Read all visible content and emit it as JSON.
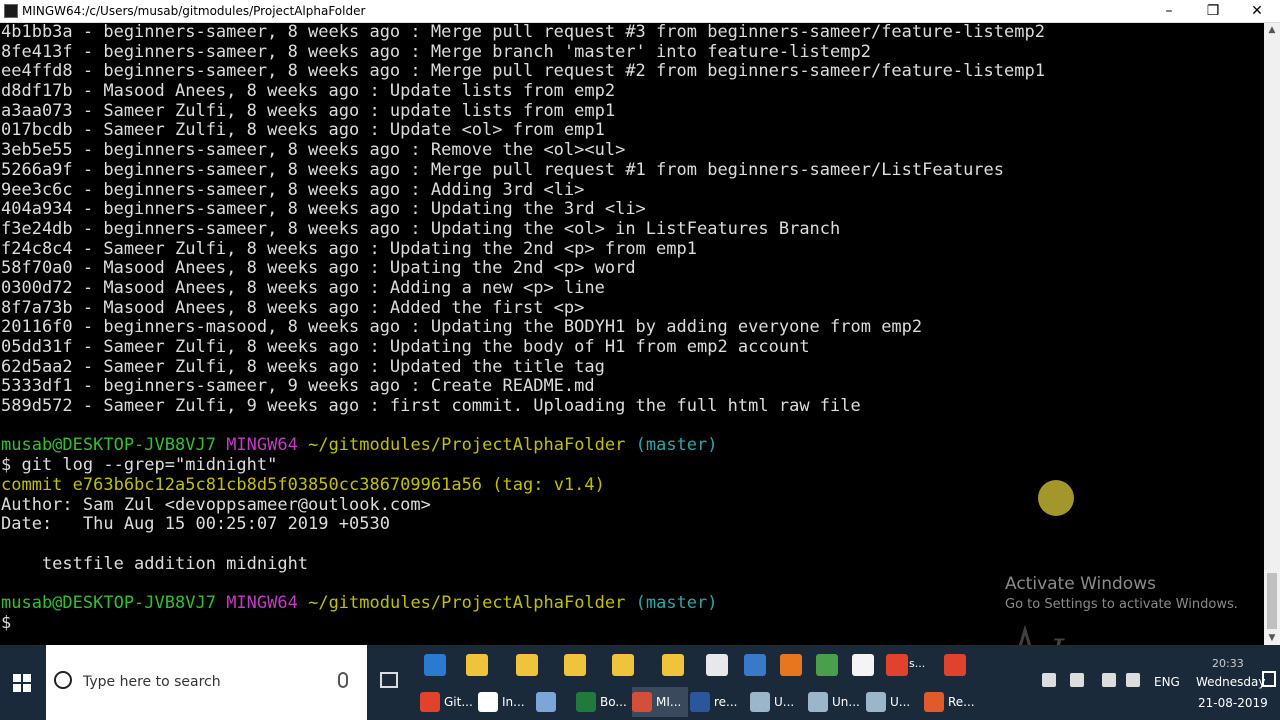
{
  "window": {
    "title": "MINGW64:/c/Users/musab/gitmodules/ProjectAlphaFolder",
    "minimize_icon": "minimize-icon",
    "maximize_icon": "maximize-icon",
    "close_icon": "close-icon"
  },
  "terminal": {
    "log_lines": [
      "4b1bb3a - beginners-sameer, 8 weeks ago : Merge pull request #3 from beginners-sameer/feature-listemp2",
      "8fe413f - beginners-sameer, 8 weeks ago : Merge branch 'master' into feature-listemp2",
      "ee4ffd8 - beginners-sameer, 8 weeks ago : Merge pull request #2 from beginners-sameer/feature-listemp1",
      "d8df17b - Masood Anees, 8 weeks ago : Update lists from emp2",
      "a3aa073 - Sameer Zulfi, 8 weeks ago : update lists from emp1",
      "017bcdb - Sameer Zulfi, 8 weeks ago : Update <ol> from emp1",
      "3eb5e55 - beginners-sameer, 8 weeks ago : Remove the <ol><ul>",
      "5266a9f - beginners-sameer, 8 weeks ago : Merge pull request #1 from beginners-sameer/ListFeatures",
      "9ee3c6c - beginners-sameer, 8 weeks ago : Adding 3rd <li>",
      "404a934 - beginners-sameer, 8 weeks ago : Updating the 3rd <li>",
      "f3e24db - beginners-sameer, 8 weeks ago : Updating the <ol> in ListFeatures Branch",
      "f24c8c4 - Sameer Zulfi, 8 weeks ago : Updating the 2nd <p> from emp1",
      "58f70a0 - Masood Anees, 8 weeks ago : Upating the 2nd <p> word",
      "0300d72 - Masood Anees, 8 weeks ago : Adding a new <p> line",
      "8f7a73b - Masood Anees, 8 weeks ago : Added the first <p>",
      "20116f0 - beginners-masood, 8 weeks ago : Updating the BODYH1 by adding everyone from emp2",
      "05dd31f - Sameer Zulfi, 8 weeks ago : Updating the body of H1 from emp2 account",
      "62d5aa2 - Sameer Zulfi, 8 weeks ago : Updated the title tag",
      "5333df1 - beginners-sameer, 9 weeks ago : Create README.md",
      "589d572 - Sameer Zulfi, 9 weeks ago : first commit. Uploading the full html raw file"
    ],
    "prompt": {
      "user_host": "musab@DESKTOP-JVB8VJ7",
      "env": "MINGW64",
      "path": "~/gitmodules/ProjectAlphaFolder",
      "branch": "(master)",
      "symbol": "$"
    },
    "command": "$ git log --grep=\"midnight\"",
    "commit_line": "commit e763b6bc12a5c81cb8d5f03850cc386709961a56",
    "tag": "(tag: v1.4)",
    "author_line": "Author: Sam Zul <devoppsameer@outlook.com>",
    "date_line": "Date:   Thu Aug 15 00:25:07 2019 +0530",
    "message_line": "    testfile addition midnight"
  },
  "overlay": {
    "activate_title": "Activate Windows",
    "activate_sub": "Go to Settings to activate Windows."
  },
  "taskbar": {
    "start_icon": "windows-start-icon",
    "search_placeholder": "Type here to search",
    "tasks": [
      {
        "label": "Git...",
        "icon": "chrome-icon",
        "color": "#e0422c"
      },
      {
        "label": "In...",
        "icon": "mail-icon",
        "color": "#ffffff"
      },
      {
        "label": "",
        "icon": "paint-icon",
        "color": "#7aa7d8"
      },
      {
        "label": "Bo...",
        "icon": "excel-icon",
        "color": "#1f7a3c"
      },
      {
        "label": "MI...",
        "icon": "git-bash-icon",
        "color": "#d44e3a"
      },
      {
        "label": "re...",
        "icon": "word-icon",
        "color": "#2b579a"
      },
      {
        "label": "U...",
        "icon": "app-icon",
        "color": "#9ab6c8"
      },
      {
        "label": "Un...",
        "icon": "app-icon",
        "color": "#9ab6c8"
      },
      {
        "label": "U...",
        "icon": "app-icon",
        "color": "#9ab6c8"
      },
      {
        "label": "Re...",
        "icon": "recorder-icon",
        "color": "#e05a2a"
      }
    ],
    "pinned_top": [
      {
        "icon": "edge-icon",
        "color": "#2a7ad0"
      },
      {
        "icon": "explorer-icon",
        "color": "#f0c43a"
      },
      {
        "icon": "explorer-icon",
        "color": "#f0c43a"
      },
      {
        "icon": "folder-icon",
        "color": "#f0c43a"
      },
      {
        "icon": "folder-icon",
        "color": "#f0c43a"
      },
      {
        "icon": "folder-icon",
        "color": "#f0c43a"
      },
      {
        "icon": "store-icon",
        "color": "#e8e8e8"
      },
      {
        "icon": "network-icon",
        "color": "#3a78c8"
      },
      {
        "icon": "firefox-icon",
        "color": "#e8761e"
      },
      {
        "icon": "settings-icon",
        "color": "#4aa04a"
      },
      {
        "icon": "file-icon",
        "color": "#f4f4f4"
      },
      {
        "icon": "chrome-icon",
        "color": "#e0422c"
      },
      {
        "icon": "chrome-icon",
        "color": "#e0422c"
      }
    ],
    "pinned_extra_label": "s...",
    "tray": {
      "language": "ENG",
      "time": "20:33",
      "day": "Wednesday",
      "date": "21-08-2019"
    }
  }
}
